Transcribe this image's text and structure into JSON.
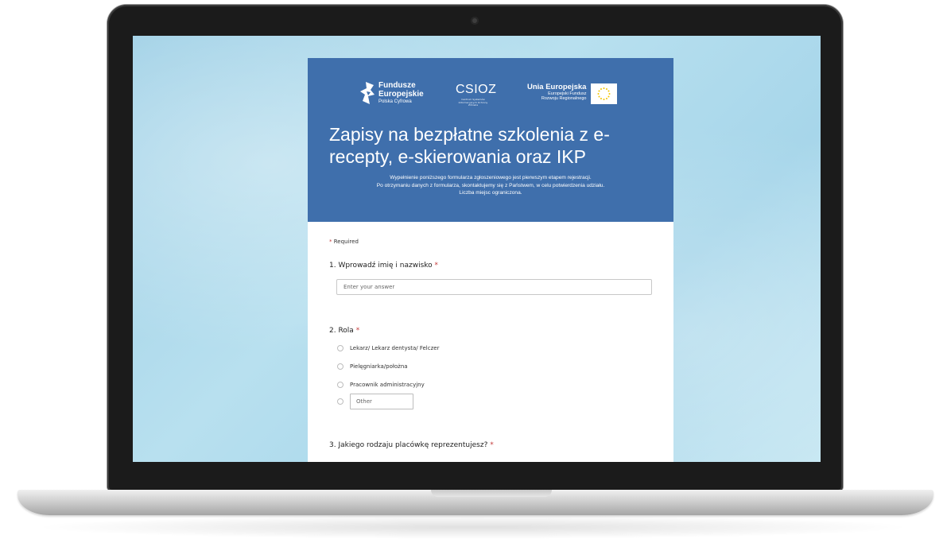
{
  "header": {
    "logo_fe": {
      "line1": "Fundusze",
      "line2": "Europejskie",
      "line3": "Polska Cyfrowa"
    },
    "logo_csioz": {
      "name": "CSIOZ",
      "subtitle": "Centrum Systemów Informacyjnych Ochrony Zdrowia"
    },
    "logo_ue": {
      "line1": "Unia Europejska",
      "line2": "Europejski Fundusz",
      "line3": "Rozwoju Regionalnego"
    },
    "title": "Zapisy na bezpłatne szkolenia z e-recepty, e-skierowania oraz IKP",
    "description": [
      "Wypełnienie poniższego formularza zgłoszeniowego jest pierwszym etapem rejestracji.",
      "Po otrzymaniu danych z formularza, skontaktujemy się z Państwem, w celu potwierdzenia udziału.",
      "Liczba miejsc ograniczona."
    ],
    "background_color": "#3f6fac"
  },
  "form": {
    "required_note": "Required",
    "required_star": "*",
    "q1": {
      "label": "1. Wprowadź imię i nazwisko",
      "placeholder": "Enter your answer"
    },
    "q2": {
      "label": "2. Rola",
      "options": [
        "Lekarz/ Lekarz dentysta/ Felczer",
        "Pielęgniarka/położna",
        "Pracownik administracyjny"
      ],
      "other_placeholder": "Other"
    },
    "q3": {
      "label": "3. Jakiego rodzaju placówkę reprezentujesz?"
    }
  }
}
